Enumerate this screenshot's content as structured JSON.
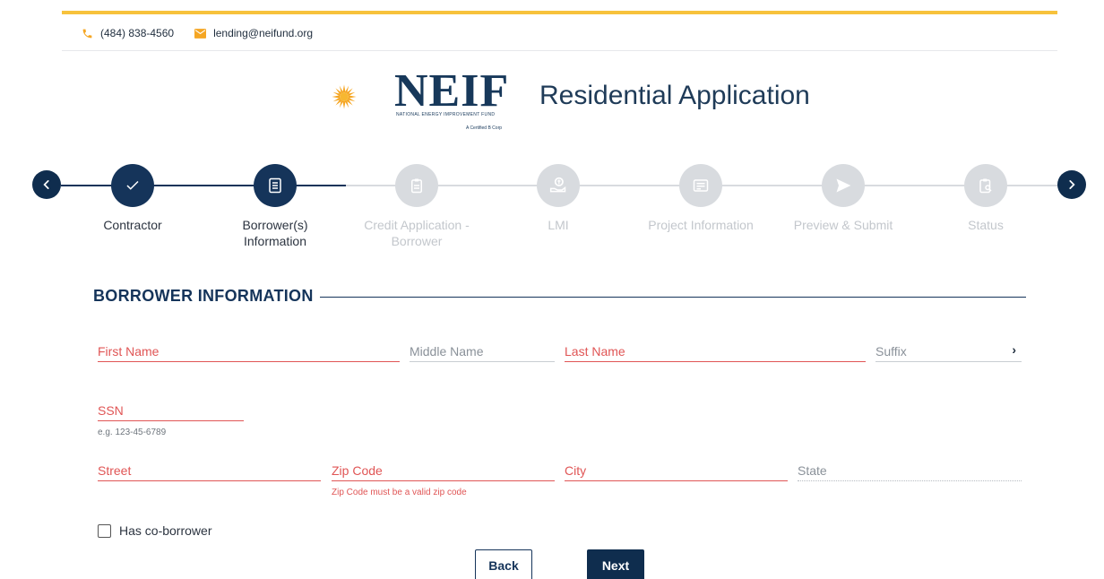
{
  "header": {
    "phone": "(484) 838-4560",
    "email": "lending@neifund.org",
    "logo_text": "NEIF",
    "logo_sub": "NATIONAL ENERGY IMPROVEMENT FUND",
    "logo_sub2": "A Certified B Corp",
    "app_title": "Residential Application"
  },
  "stepper": {
    "steps": [
      {
        "label": "Contractor",
        "icon": "check-icon",
        "state": "done"
      },
      {
        "label": "Borrower(s)\nInformation",
        "icon": "document-icon",
        "state": "active"
      },
      {
        "label": "Credit Application -\nBorrower",
        "icon": "clipboard-icon",
        "state": "todo"
      },
      {
        "label": "LMI",
        "icon": "money-hand-icon",
        "state": "todo"
      },
      {
        "label": "Project Information",
        "icon": "id-card-icon",
        "state": "todo"
      },
      {
        "label": "Preview & Submit",
        "icon": "send-icon",
        "state": "todo"
      },
      {
        "label": "Status",
        "icon": "clipboard-search-icon",
        "state": "todo"
      }
    ]
  },
  "form": {
    "section_title": "BORROWER INFORMATION",
    "first_name": {
      "placeholder": "First Name",
      "value": ""
    },
    "middle_name": {
      "placeholder": "Middle Name",
      "value": ""
    },
    "last_name": {
      "placeholder": "Last Name",
      "value": ""
    },
    "suffix": {
      "placeholder": "Suffix",
      "value": ""
    },
    "ssn": {
      "placeholder": "SSN",
      "value": "",
      "hint": "e.g. 123-45-6789"
    },
    "street": {
      "placeholder": "Street",
      "value": ""
    },
    "zip": {
      "placeholder": "Zip Code",
      "value": "",
      "error": "Zip Code must be a valid zip code"
    },
    "city": {
      "placeholder": "City",
      "value": ""
    },
    "state": {
      "placeholder": "State",
      "value": ""
    },
    "co_borrower_label": "Has co-borrower"
  },
  "buttons": {
    "back": "Back",
    "next": "Next"
  },
  "colors": {
    "accent_yellow": "#f7c23c",
    "navy": "#15345a",
    "error_red": "#e05555",
    "inactive_grey": "#d8dbdf"
  }
}
